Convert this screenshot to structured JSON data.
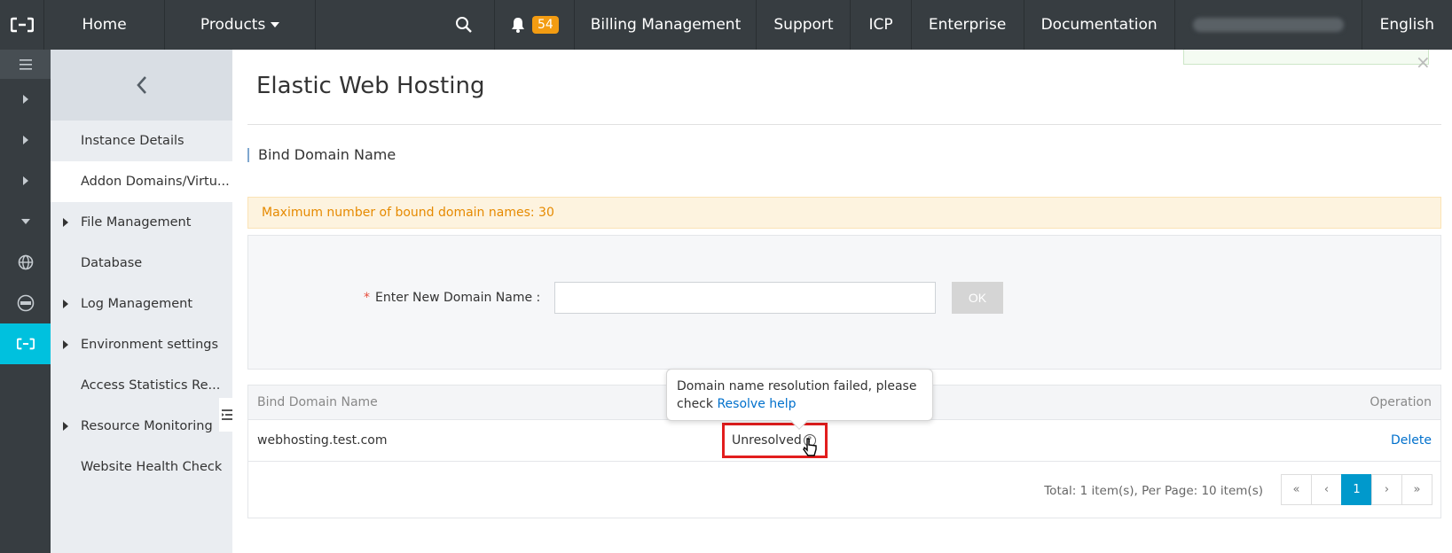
{
  "topbar": {
    "home": "Home",
    "products": "Products",
    "notifications_count": "54",
    "billing": "Billing Management",
    "support": "Support",
    "icp": "ICP",
    "enterprise": "Enterprise",
    "documentation": "Documentation",
    "language": "English"
  },
  "sidebar": {
    "items": [
      {
        "label": "Instance Details"
      },
      {
        "label": "Addon Domains/Virtu..."
      },
      {
        "label": "File Management"
      },
      {
        "label": "Database"
      },
      {
        "label": "Log Management"
      },
      {
        "label": "Environment settings"
      },
      {
        "label": "Access Statistics Re..."
      },
      {
        "label": "Resource Monitoring"
      },
      {
        "label": "Website Health Check"
      }
    ]
  },
  "main": {
    "title": "Elastic Web Hosting",
    "section_title": "Bind Domain Name",
    "notice": "Maximum number of bound domain names: 30",
    "form": {
      "label": "Enter New Domain Name :",
      "input_value": "",
      "ok_label": "OK"
    },
    "table": {
      "headers": {
        "domain": "Bind Domain Name",
        "operation": "Operation"
      },
      "rows": [
        {
          "domain": "webhosting.test.com",
          "status": "Unresolved",
          "operation": "Delete"
        }
      ]
    },
    "tooltip": {
      "text": "Domain name resolution failed, please check",
      "link": "Resolve help"
    },
    "pagination": {
      "info": "Total: 1 item(s),   Per Page: 10 item(s)",
      "first": "«",
      "prev": "‹",
      "current": "1",
      "next": "›",
      "last": "»"
    }
  },
  "colors": {
    "topbar_bg": "#373d41",
    "accent": "#00c1de",
    "link": "#0070cc",
    "notice_text": "#e68a00",
    "highlight_border": "#e21d1d"
  }
}
